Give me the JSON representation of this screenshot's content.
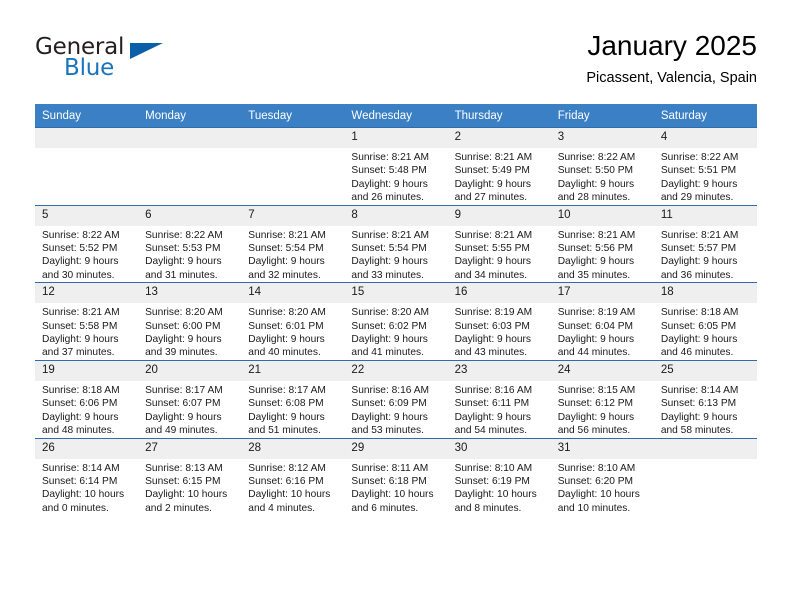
{
  "brand": {
    "name_part1": "General",
    "name_part2": "Blue",
    "flag_icon": "blue-flag-icon"
  },
  "header": {
    "title": "January 2025",
    "subtitle": "Picassent, Valencia, Spain"
  },
  "colors": {
    "header_blue": "#3b7fc4",
    "grid_line_blue": "#2f6ca8",
    "daynum_band": "#efefef",
    "brand_blue": "#1a74bb",
    "text": "#1a1a1a"
  },
  "weekday_headers": [
    "Sunday",
    "Monday",
    "Tuesday",
    "Wednesday",
    "Thursday",
    "Friday",
    "Saturday"
  ],
  "weeks": [
    [
      {
        "day": "",
        "sunrise": "",
        "sunset": "",
        "daylight_line1": "",
        "daylight_line2": ""
      },
      {
        "day": "",
        "sunrise": "",
        "sunset": "",
        "daylight_line1": "",
        "daylight_line2": ""
      },
      {
        "day": "",
        "sunrise": "",
        "sunset": "",
        "daylight_line1": "",
        "daylight_line2": ""
      },
      {
        "day": "1",
        "sunrise": "Sunrise: 8:21 AM",
        "sunset": "Sunset: 5:48 PM",
        "daylight_line1": "Daylight: 9 hours",
        "daylight_line2": "and 26 minutes."
      },
      {
        "day": "2",
        "sunrise": "Sunrise: 8:21 AM",
        "sunset": "Sunset: 5:49 PM",
        "daylight_line1": "Daylight: 9 hours",
        "daylight_line2": "and 27 minutes."
      },
      {
        "day": "3",
        "sunrise": "Sunrise: 8:22 AM",
        "sunset": "Sunset: 5:50 PM",
        "daylight_line1": "Daylight: 9 hours",
        "daylight_line2": "and 28 minutes."
      },
      {
        "day": "4",
        "sunrise": "Sunrise: 8:22 AM",
        "sunset": "Sunset: 5:51 PM",
        "daylight_line1": "Daylight: 9 hours",
        "daylight_line2": "and 29 minutes."
      }
    ],
    [
      {
        "day": "5",
        "sunrise": "Sunrise: 8:22 AM",
        "sunset": "Sunset: 5:52 PM",
        "daylight_line1": "Daylight: 9 hours",
        "daylight_line2": "and 30 minutes."
      },
      {
        "day": "6",
        "sunrise": "Sunrise: 8:22 AM",
        "sunset": "Sunset: 5:53 PM",
        "daylight_line1": "Daylight: 9 hours",
        "daylight_line2": "and 31 minutes."
      },
      {
        "day": "7",
        "sunrise": "Sunrise: 8:21 AM",
        "sunset": "Sunset: 5:54 PM",
        "daylight_line1": "Daylight: 9 hours",
        "daylight_line2": "and 32 minutes."
      },
      {
        "day": "8",
        "sunrise": "Sunrise: 8:21 AM",
        "sunset": "Sunset: 5:54 PM",
        "daylight_line1": "Daylight: 9 hours",
        "daylight_line2": "and 33 minutes."
      },
      {
        "day": "9",
        "sunrise": "Sunrise: 8:21 AM",
        "sunset": "Sunset: 5:55 PM",
        "daylight_line1": "Daylight: 9 hours",
        "daylight_line2": "and 34 minutes."
      },
      {
        "day": "10",
        "sunrise": "Sunrise: 8:21 AM",
        "sunset": "Sunset: 5:56 PM",
        "daylight_line1": "Daylight: 9 hours",
        "daylight_line2": "and 35 minutes."
      },
      {
        "day": "11",
        "sunrise": "Sunrise: 8:21 AM",
        "sunset": "Sunset: 5:57 PM",
        "daylight_line1": "Daylight: 9 hours",
        "daylight_line2": "and 36 minutes."
      }
    ],
    [
      {
        "day": "12",
        "sunrise": "Sunrise: 8:21 AM",
        "sunset": "Sunset: 5:58 PM",
        "daylight_line1": "Daylight: 9 hours",
        "daylight_line2": "and 37 minutes."
      },
      {
        "day": "13",
        "sunrise": "Sunrise: 8:20 AM",
        "sunset": "Sunset: 6:00 PM",
        "daylight_line1": "Daylight: 9 hours",
        "daylight_line2": "and 39 minutes."
      },
      {
        "day": "14",
        "sunrise": "Sunrise: 8:20 AM",
        "sunset": "Sunset: 6:01 PM",
        "daylight_line1": "Daylight: 9 hours",
        "daylight_line2": "and 40 minutes."
      },
      {
        "day": "15",
        "sunrise": "Sunrise: 8:20 AM",
        "sunset": "Sunset: 6:02 PM",
        "daylight_line1": "Daylight: 9 hours",
        "daylight_line2": "and 41 minutes."
      },
      {
        "day": "16",
        "sunrise": "Sunrise: 8:19 AM",
        "sunset": "Sunset: 6:03 PM",
        "daylight_line1": "Daylight: 9 hours",
        "daylight_line2": "and 43 minutes."
      },
      {
        "day": "17",
        "sunrise": "Sunrise: 8:19 AM",
        "sunset": "Sunset: 6:04 PM",
        "daylight_line1": "Daylight: 9 hours",
        "daylight_line2": "and 44 minutes."
      },
      {
        "day": "18",
        "sunrise": "Sunrise: 8:18 AM",
        "sunset": "Sunset: 6:05 PM",
        "daylight_line1": "Daylight: 9 hours",
        "daylight_line2": "and 46 minutes."
      }
    ],
    [
      {
        "day": "19",
        "sunrise": "Sunrise: 8:18 AM",
        "sunset": "Sunset: 6:06 PM",
        "daylight_line1": "Daylight: 9 hours",
        "daylight_line2": "and 48 minutes."
      },
      {
        "day": "20",
        "sunrise": "Sunrise: 8:17 AM",
        "sunset": "Sunset: 6:07 PM",
        "daylight_line1": "Daylight: 9 hours",
        "daylight_line2": "and 49 minutes."
      },
      {
        "day": "21",
        "sunrise": "Sunrise: 8:17 AM",
        "sunset": "Sunset: 6:08 PM",
        "daylight_line1": "Daylight: 9 hours",
        "daylight_line2": "and 51 minutes."
      },
      {
        "day": "22",
        "sunrise": "Sunrise: 8:16 AM",
        "sunset": "Sunset: 6:09 PM",
        "daylight_line1": "Daylight: 9 hours",
        "daylight_line2": "and 53 minutes."
      },
      {
        "day": "23",
        "sunrise": "Sunrise: 8:16 AM",
        "sunset": "Sunset: 6:11 PM",
        "daylight_line1": "Daylight: 9 hours",
        "daylight_line2": "and 54 minutes."
      },
      {
        "day": "24",
        "sunrise": "Sunrise: 8:15 AM",
        "sunset": "Sunset: 6:12 PM",
        "daylight_line1": "Daylight: 9 hours",
        "daylight_line2": "and 56 minutes."
      },
      {
        "day": "25",
        "sunrise": "Sunrise: 8:14 AM",
        "sunset": "Sunset: 6:13 PM",
        "daylight_line1": "Daylight: 9 hours",
        "daylight_line2": "and 58 minutes."
      }
    ],
    [
      {
        "day": "26",
        "sunrise": "Sunrise: 8:14 AM",
        "sunset": "Sunset: 6:14 PM",
        "daylight_line1": "Daylight: 10 hours",
        "daylight_line2": "and 0 minutes."
      },
      {
        "day": "27",
        "sunrise": "Sunrise: 8:13 AM",
        "sunset": "Sunset: 6:15 PM",
        "daylight_line1": "Daylight: 10 hours",
        "daylight_line2": "and 2 minutes."
      },
      {
        "day": "28",
        "sunrise": "Sunrise: 8:12 AM",
        "sunset": "Sunset: 6:16 PM",
        "daylight_line1": "Daylight: 10 hours",
        "daylight_line2": "and 4 minutes."
      },
      {
        "day": "29",
        "sunrise": "Sunrise: 8:11 AM",
        "sunset": "Sunset: 6:18 PM",
        "daylight_line1": "Daylight: 10 hours",
        "daylight_line2": "and 6 minutes."
      },
      {
        "day": "30",
        "sunrise": "Sunrise: 8:10 AM",
        "sunset": "Sunset: 6:19 PM",
        "daylight_line1": "Daylight: 10 hours",
        "daylight_line2": "and 8 minutes."
      },
      {
        "day": "31",
        "sunrise": "Sunrise: 8:10 AM",
        "sunset": "Sunset: 6:20 PM",
        "daylight_line1": "Daylight: 10 hours",
        "daylight_line2": "and 10 minutes."
      },
      {
        "day": "",
        "sunrise": "",
        "sunset": "",
        "daylight_line1": "",
        "daylight_line2": ""
      }
    ]
  ]
}
